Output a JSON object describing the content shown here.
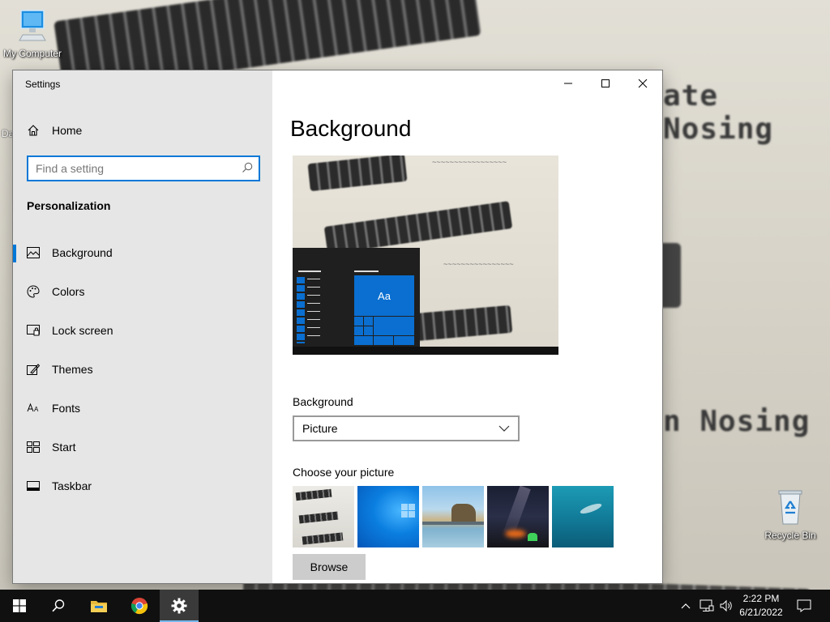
{
  "desktop": {
    "icons": [
      {
        "label": "My Computer"
      },
      {
        "label": "Recycle Bin"
      }
    ],
    "wallpaper_text": [
      "ate Nosing",
      "n Nosing"
    ],
    "partial_icon_label": "Da"
  },
  "window": {
    "title": "Settings",
    "controls": {
      "minimize": "minimize-icon",
      "maximize": "maximize-icon",
      "close": "close-icon"
    }
  },
  "sidebar": {
    "home_label": "Home",
    "search_placeholder": "Find a setting",
    "section_title": "Personalization",
    "items": [
      {
        "label": "Background",
        "icon": "picture-icon",
        "active": true
      },
      {
        "label": "Colors",
        "icon": "palette-icon",
        "active": false
      },
      {
        "label": "Lock screen",
        "icon": "lock-screen-icon",
        "active": false
      },
      {
        "label": "Themes",
        "icon": "themes-icon",
        "active": false
      },
      {
        "label": "Fonts",
        "icon": "fonts-icon",
        "active": false
      },
      {
        "label": "Start",
        "icon": "start-icon",
        "active": false
      },
      {
        "label": "Taskbar",
        "icon": "taskbar-icon",
        "active": false
      }
    ]
  },
  "main": {
    "page_title": "Background",
    "preview_tile_text": "Aa",
    "background_label": "Background",
    "background_value": "Picture",
    "choose_label": "Choose your picture",
    "browse_label": "Browse"
  },
  "taskbar": {
    "time": "2:22 PM",
    "date": "6/21/2022"
  },
  "colors": {
    "accent": "#0078d7",
    "sidebar_bg": "#e6e6e6",
    "taskbar_bg": "#101010"
  }
}
